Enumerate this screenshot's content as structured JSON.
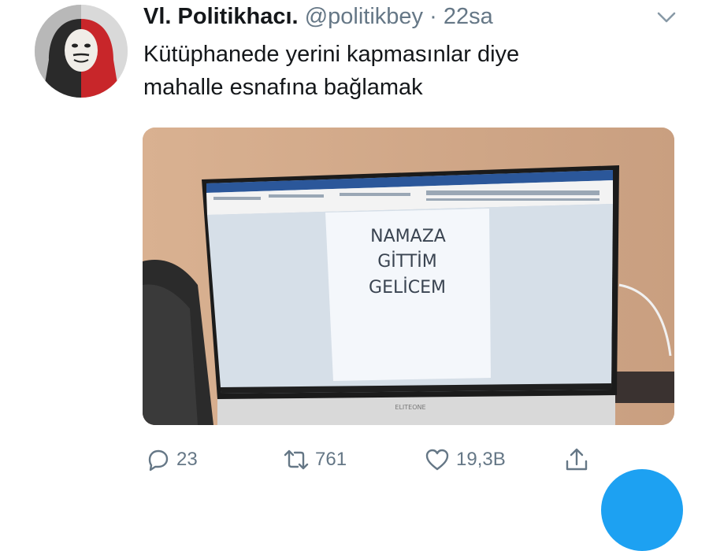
{
  "tweet": {
    "display_name": "Vl. Politikhacı.",
    "handle": "@politikbey",
    "separator": "·",
    "time": "22sa",
    "text_lines": [
      "Kütüphanede yerini kapmasınlar diye",
      "mahalle esnafına bağlamak"
    ]
  },
  "media": {
    "screen_text_lines": [
      "NAMAZA",
      "GİTTİM",
      "GELİCEM"
    ],
    "monitor_brand": "ELITEONE"
  },
  "actions": {
    "reply_count": "23",
    "retweet_count": "761",
    "like_count": "19,3B"
  },
  "colors": {
    "text": "#14171a",
    "muted": "#657786",
    "accent": "#1da1f2"
  }
}
